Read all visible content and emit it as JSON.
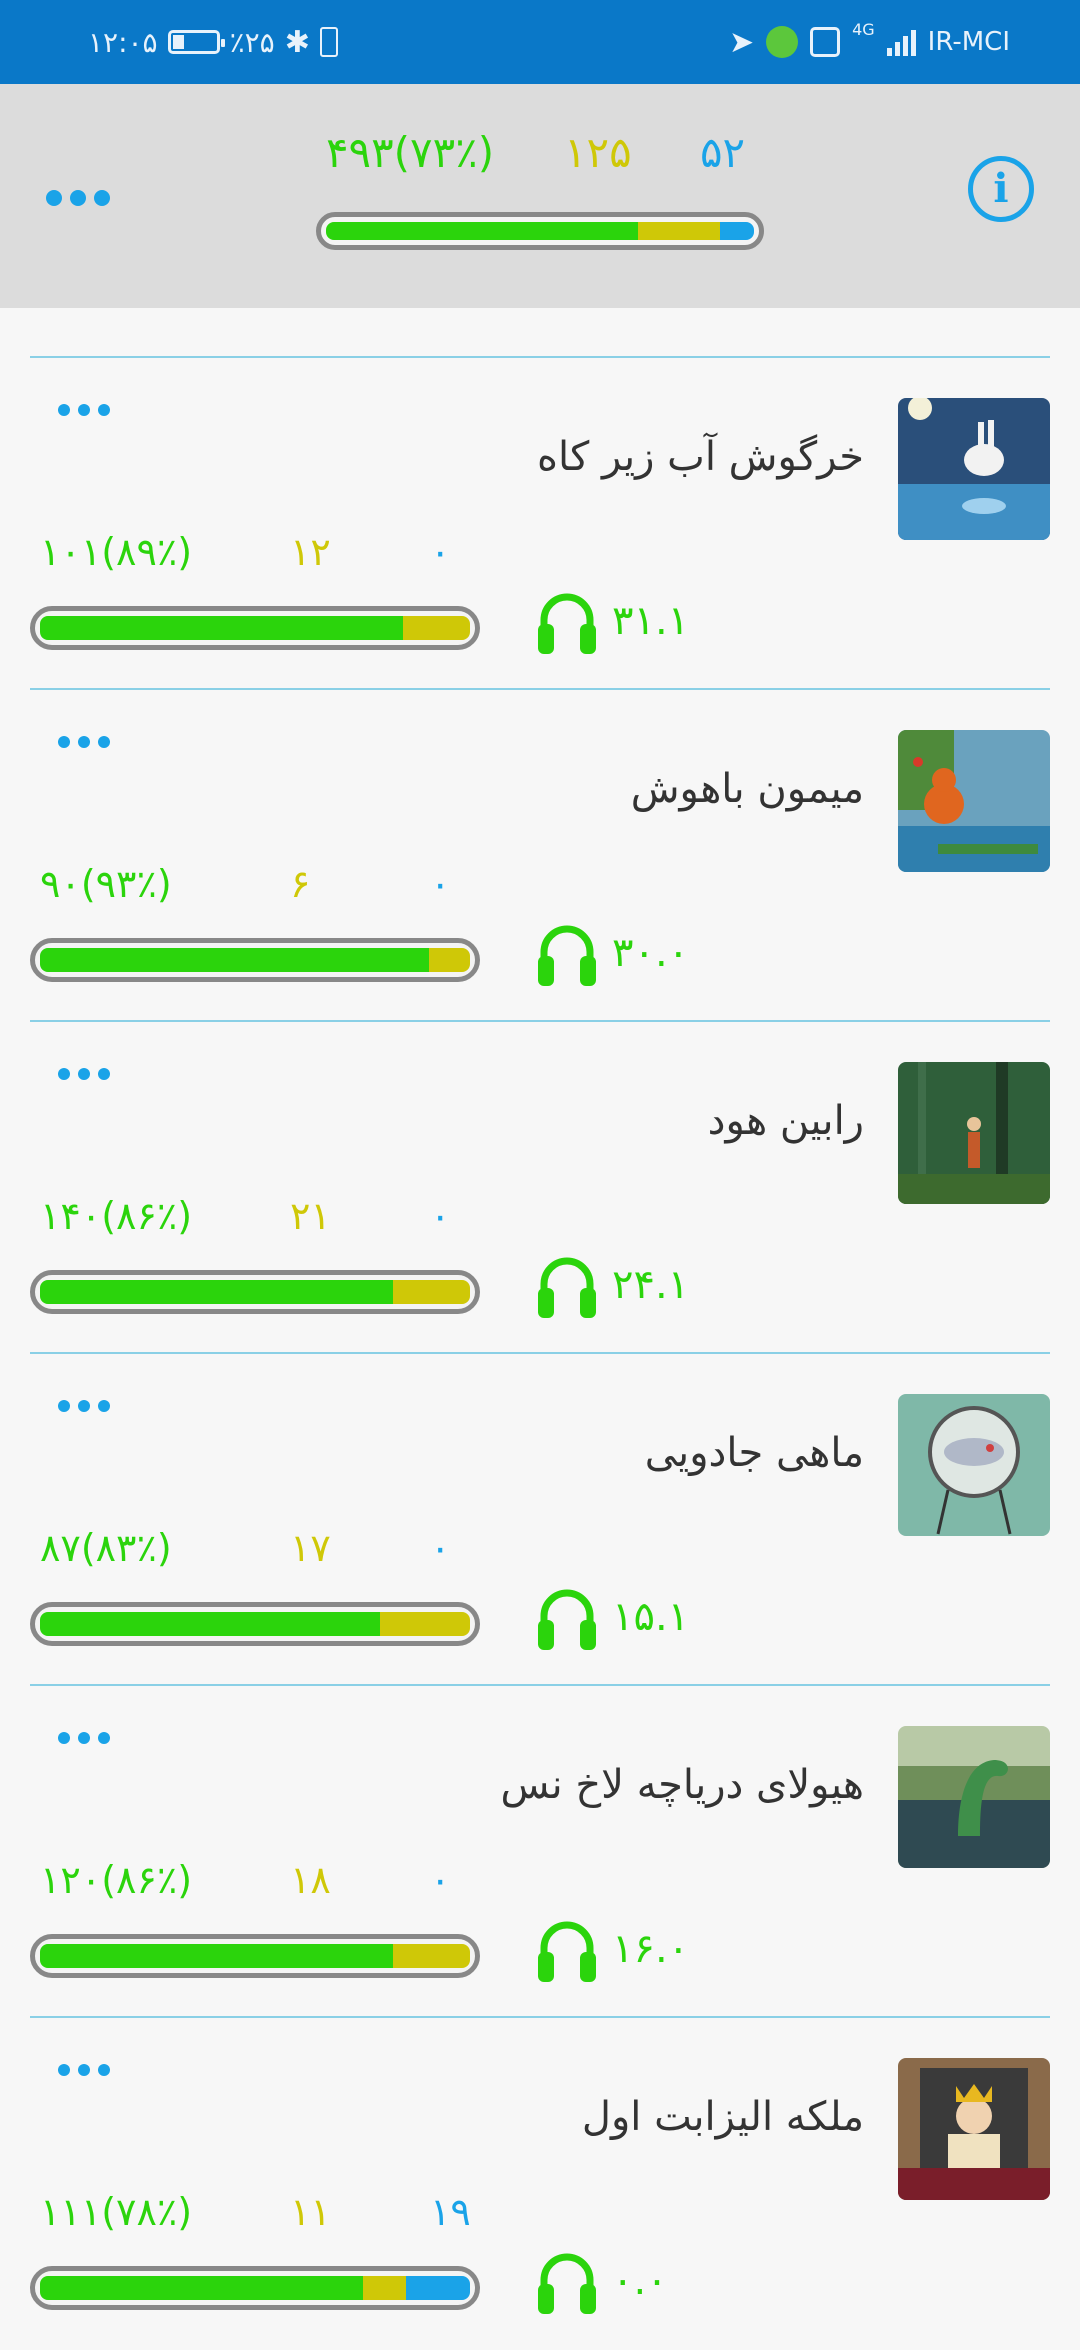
{
  "status_bar": {
    "time": "۱۲:۰۵",
    "battery": "٪۲۵",
    "network_gen": "4G",
    "carrier": "IR-MCI"
  },
  "header": {
    "summary": {
      "blue": "۵۲",
      "yellow": "۱۲۵",
      "green": "۴۹۳(۷۳٪)",
      "green_frac": 0.73,
      "yellow_frac": 0.19,
      "blue_frac": 0.08
    },
    "icons": {
      "menu": "more-dots-icon",
      "info": "info-icon"
    }
  },
  "colors": {
    "green": "#2bd40c",
    "yellow": "#cfc807",
    "blue": "#1aa3e8",
    "appbar": "#0a78c8"
  },
  "stories": [
    {
      "title": "خرگوش آب زیر کاه",
      "green": "۱۰۱(۸۹٪)",
      "yellow": "۱۲",
      "blue": "۰",
      "listens": "۳۱.۱",
      "green_frac": 0.845,
      "yellow_frac": 0.155,
      "blue_frac": 0
    },
    {
      "title": "میمون باهوش",
      "green": "۹۰(۹۳٪)",
      "yellow": "۶",
      "blue": "۰",
      "listens": "۳۰.۰",
      "green_frac": 0.905,
      "yellow_frac": 0.095,
      "blue_frac": 0
    },
    {
      "title": "رابین هود",
      "green": "۱۴۰(۸۶٪)",
      "yellow": "۲۱",
      "blue": "۰",
      "listens": "۲۴.۱",
      "green_frac": 0.82,
      "yellow_frac": 0.18,
      "blue_frac": 0
    },
    {
      "title": "ماهی جادویی",
      "green": "۸۷(۸۳٪)",
      "yellow": "۱۷",
      "blue": "۰",
      "listens": "۱۵.۱",
      "green_frac": 0.79,
      "yellow_frac": 0.21,
      "blue_frac": 0
    },
    {
      "title": "هیولای دریاچه لاخ نس",
      "green": "۱۲۰(۸۶٪)",
      "yellow": "۱۸",
      "blue": "۰",
      "listens": "۱۶.۰",
      "green_frac": 0.82,
      "yellow_frac": 0.18,
      "blue_frac": 0
    },
    {
      "title": "ملکه الیزابت اول",
      "green": "۱۱۱(۷۸٪)",
      "yellow": "۱۱",
      "blue": "۱۹",
      "listens": "۰.۰",
      "green_frac": 0.75,
      "yellow_frac": 0.1,
      "blue_frac": 0.15
    }
  ]
}
